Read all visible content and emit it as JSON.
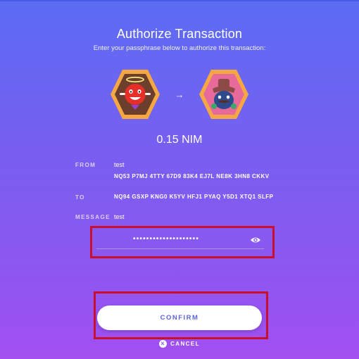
{
  "header": {
    "title": "Authorize Transaction",
    "subtitle": "Enter your passphrase below to authorize this transaction:"
  },
  "identicons": {
    "sender_icon": "angel-avatar-icon",
    "arrow": "→",
    "recipient_icon": "hat-avatar-icon"
  },
  "amount": "0.15 NIM",
  "details": {
    "from_label": "FROM",
    "from_name": "test",
    "from_address": "NQ53 P7MJ 4TTY 67D9 83K4 EJ7L NE8K 3HN8 CKKV",
    "to_label": "TO",
    "to_address": "NQ94 GSXP KNG0 K5YV HFJ1 PYAQ Y5D1 XTQ1 SLFP",
    "message_label": "MESSAGE",
    "message": "test"
  },
  "passphrase": {
    "masked_value": "••••••••••••••••••••",
    "toggle_icon": "eye-icon"
  },
  "actions": {
    "confirm_label": "CONFIRM",
    "cancel_label": "CANCEL",
    "cancel_icon": "close-circle-icon"
  },
  "colors": {
    "gradient_top": "#5b6cf3",
    "gradient_bottom": "#a24ff0",
    "confirm_text": "#5a64d6",
    "highlight_border": "#c8102e"
  }
}
